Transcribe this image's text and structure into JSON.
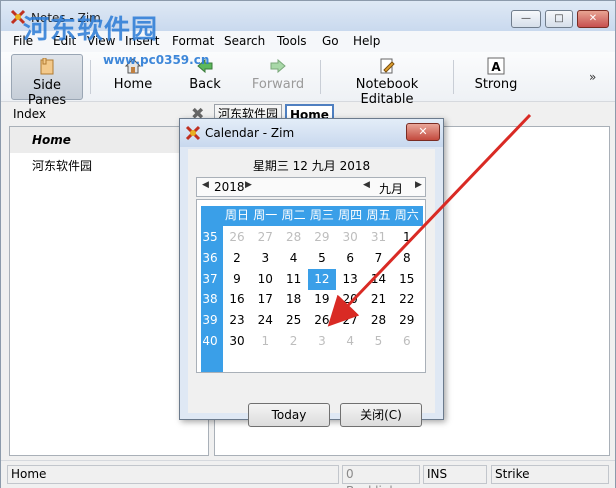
{
  "window": {
    "title": "Notes - Zim",
    "buttons": [
      "—",
      "□",
      "✕"
    ]
  },
  "watermark": {
    "text": "河东软件园",
    "url": "www.pc0359.cn"
  },
  "menu": [
    "File",
    "Edit",
    "View",
    "Insert",
    "Format",
    "Search",
    "Tools",
    "Go",
    "Help"
  ],
  "toolbar": {
    "side_panes": "Side Panes",
    "home": "Home",
    "back": "Back",
    "forward": "Forward",
    "notebook_editable": "Notebook Editable",
    "strong": "Strong",
    "more": "»"
  },
  "index": {
    "label": "Index",
    "close": "✖",
    "items": [
      "Home",
      "河东软件园"
    ]
  },
  "crumbs": [
    "河东软件园",
    "Home"
  ],
  "status": {
    "page": "Home",
    "backlinks": "0 Backlinks...",
    "ins": "INS",
    "strike": "Strike"
  },
  "dialog": {
    "title": "Calendar - Zim",
    "close": "✕",
    "date": "星期三 12 九月 2018",
    "year": "2018",
    "month": "九月",
    "weekdays": [
      "周日",
      "周一",
      "周二",
      "周三",
      "周四",
      "周五",
      "周六"
    ],
    "weeks": [
      "35",
      "36",
      "37",
      "38",
      "39",
      "40"
    ],
    "days": [
      [
        "26",
        "27",
        "28",
        "29",
        "30",
        "31",
        "1"
      ],
      [
        "2",
        "3",
        "4",
        "5",
        "6",
        "7",
        "8"
      ],
      [
        "9",
        "10",
        "11",
        "12",
        "13",
        "14",
        "15"
      ],
      [
        "16",
        "17",
        "18",
        "19",
        "20",
        "21",
        "22"
      ],
      [
        "23",
        "24",
        "25",
        "26",
        "27",
        "28",
        "29"
      ],
      [
        "30",
        "1",
        "2",
        "3",
        "4",
        "5",
        "6"
      ]
    ],
    "today_button": "Today",
    "close_button": "关闭(C)"
  },
  "colors": {
    "accent": "#3a9fe8",
    "arrow": "#d92a24"
  }
}
